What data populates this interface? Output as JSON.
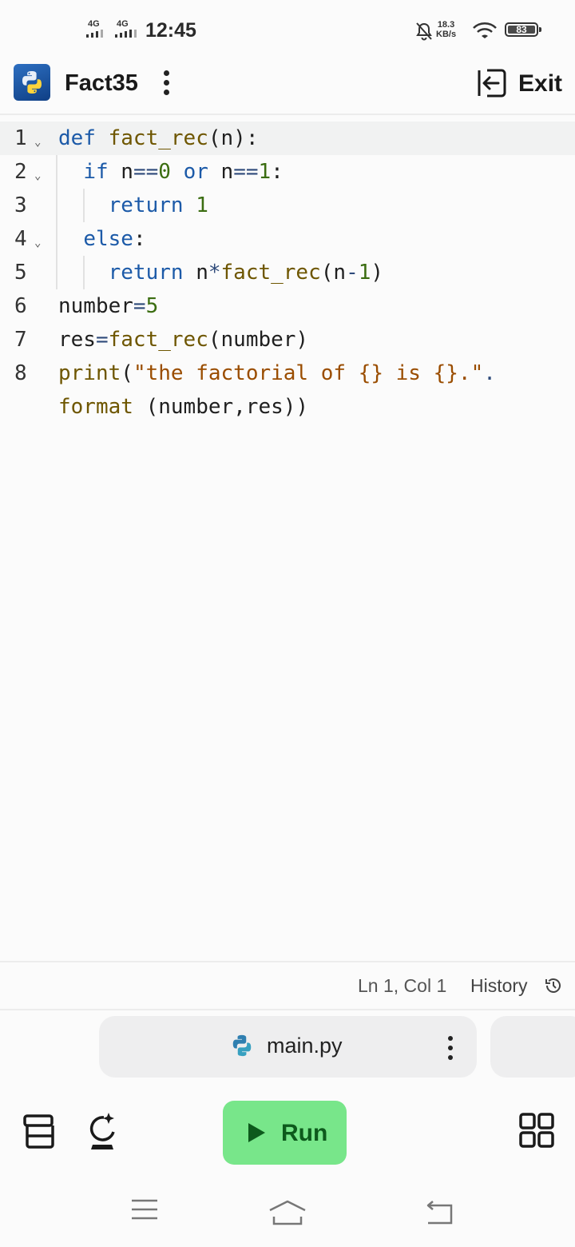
{
  "status": {
    "network1": "4G",
    "network2": "4G",
    "time": "12:45",
    "speed_value": "18.3",
    "speed_unit": "KB/s",
    "battery": "83",
    "icons": [
      "signal-icon",
      "signal-icon",
      "mute-icon",
      "wifi-icon",
      "battery-icon"
    ]
  },
  "appbar": {
    "title": "Fact35",
    "exit_label": "Exit",
    "icons": [
      "python-logo",
      "kebab-menu-icon",
      "exit-icon"
    ]
  },
  "editor": {
    "lines": [
      {
        "n": "1",
        "fold": true,
        "active": true,
        "code": "def fact_rec(n):"
      },
      {
        "n": "2",
        "fold": true,
        "code": "  if n==0 or n==1:"
      },
      {
        "n": "3",
        "fold": false,
        "code": "    return 1"
      },
      {
        "n": "4",
        "fold": true,
        "code": "  else:"
      },
      {
        "n": "5",
        "fold": false,
        "code": "    return n*fact_rec(n-1)"
      },
      {
        "n": "6",
        "fold": false,
        "code": "number=5"
      },
      {
        "n": "7",
        "fold": false,
        "code": "res=fact_rec(number)"
      },
      {
        "n": "8",
        "fold": false,
        "code": "print(\"the factorial of {} is {}.\".format (number,res))"
      }
    ],
    "line8_part1": "print(\"the factorial of {} is {}.\".",
    "line8_part2": "format (number,res))"
  },
  "infobar": {
    "position": "Ln 1, Col 1",
    "history_label": "History"
  },
  "tabs": {
    "active_file": "main.py"
  },
  "toolbar": {
    "run_label": "Run",
    "icons": [
      "layers-icon",
      "ai-assist-icon",
      "play-icon",
      "grid-icon"
    ]
  },
  "colors": {
    "keyword": "#1c5aa8",
    "function": "#6e5600",
    "number": "#3b6d11",
    "string": "#9a4d00",
    "run_button": "#78e68a"
  }
}
